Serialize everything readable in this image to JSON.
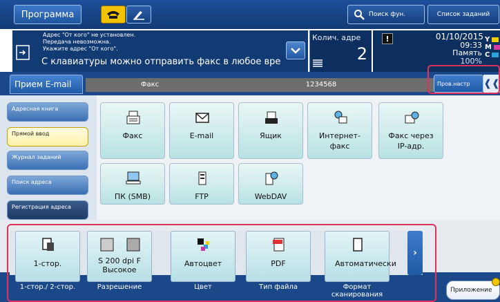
{
  "header": {
    "program_label": "Программа",
    "search_label": "Поиск фун.",
    "jobs_label": "Список заданий"
  },
  "info": {
    "warning_lines": [
      "Адрес \"От кого\" не установлен.",
      "Передача невозможна.",
      "Укажите адрес \"От кого\"."
    ],
    "message": "С клавиатуры можно отправить факс в любое вре",
    "count_label": "Колич. адре",
    "count_value": "2",
    "warn_icon": "!",
    "date": "01/10/2015",
    "time": "09:33",
    "memory_label": "Память",
    "memory_pct": "100%",
    "inks": [
      {
        "letter": "Y",
        "color": "#f1d000"
      },
      {
        "letter": "M",
        "color": "#d63aa0"
      },
      {
        "letter": "C",
        "color": "#2aa0e0"
      }
    ]
  },
  "tabs": {
    "email_rx": "Прием E-mail",
    "dest_type": "Факс",
    "dest_number": "1234568",
    "check_settings": "Пров.настр"
  },
  "nav": [
    {
      "label": "Адресная книга"
    },
    {
      "label": "Прямой ввод"
    },
    {
      "label": "Журнал заданий"
    },
    {
      "label": "Поиск адреса"
    },
    {
      "label": "Регистрация адреса"
    }
  ],
  "destinations": [
    {
      "label": "Факс"
    },
    {
      "label": "E-mail"
    },
    {
      "label": "Ящик"
    },
    {
      "label": "Интернет-факс"
    },
    {
      "label": "Факс через IP-адр."
    },
    {
      "label": "ПК (SMB)"
    },
    {
      "label": "FTP"
    },
    {
      "label": "WebDAV"
    }
  ],
  "controls": [
    {
      "value": "1-стор.",
      "label": "1-стор./ 2-стор."
    },
    {
      "value": "S 200 dpi F Высокое",
      "label": "Разрешение"
    },
    {
      "value": "Автоцвет",
      "label": "Цвет"
    },
    {
      "value": "PDF",
      "label": "Тип файла"
    },
    {
      "value": "Автоматически",
      "label": "Формат сканирования"
    }
  ],
  "footer": {
    "app_label": "Приложение"
  }
}
